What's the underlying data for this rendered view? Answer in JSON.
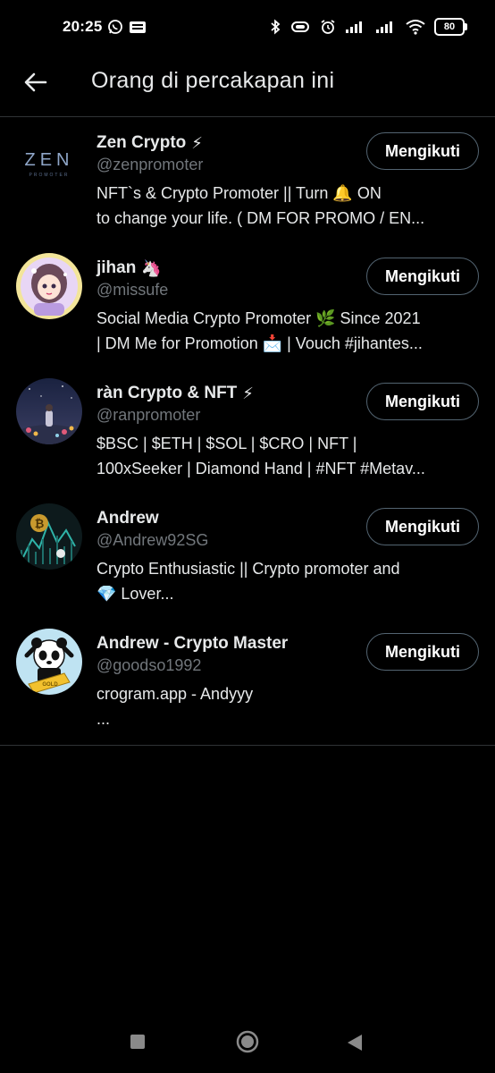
{
  "status_bar": {
    "time": "20:25",
    "battery": "80",
    "icons": [
      "whatsapp-icon",
      "app-notification-icon",
      "bluetooth-icon",
      "vibrate-icon",
      "alarm-icon",
      "signal-icon",
      "signal-icon",
      "wifi-icon",
      "battery-icon"
    ]
  },
  "header": {
    "title": "Orang di percakapan ini",
    "back_icon": "arrow-left-icon"
  },
  "people": [
    {
      "name": "Zen Crypto",
      "name_emoji": "⚡",
      "handle": "@zenpromoter",
      "bio_line1": "NFT`s & Crypto Promoter || Turn 🔔 ON",
      "bio_line2": "to change your life. ( DM FOR PROMO / EN...",
      "follow_label": "Mengikuti",
      "avatar_text": "ZEN",
      "avatar_subtext": "PROMOTER"
    },
    {
      "name": "jihan",
      "name_emoji": "🦄",
      "handle": "@missufe",
      "bio_line1": "Social Media Crypto Promoter 🌿 Since 2021",
      "bio_line2": "| DM Me for Promotion 📩 | Vouch #jihantes...",
      "follow_label": "Mengikuti"
    },
    {
      "name": "ràn Crypto & NFT",
      "name_emoji": "⚡",
      "handle": "@ranpromoter",
      "bio_line1": "$BSC | $ETH | $SOL | $CRO | NFT |",
      "bio_line2": "100xSeeker | Diamond Hand | #NFT #Metav...",
      "follow_label": "Mengikuti"
    },
    {
      "name": "Andrew",
      "name_emoji": "",
      "handle": "@Andrew92SG",
      "bio_line1": "Crypto Enthusiastic || Crypto promoter and",
      "bio_line2": "💎 Lover...",
      "follow_label": "Mengikuti"
    },
    {
      "name": "Andrew - Crypto Master",
      "name_emoji": "",
      "handle": "@goodso1992",
      "bio_line1": "crogram.app - Andyyy",
      "bio_line2": "...",
      "follow_label": "Mengikuti"
    }
  ],
  "nav_bar": {
    "icons": [
      "recents-square-icon",
      "home-circle-icon",
      "back-triangle-icon"
    ]
  },
  "colors": {
    "background": "#000000",
    "text_primary": "#e7e9ea",
    "text_secondary": "#71767b",
    "divider": "#2f3336",
    "button_border": "#536471"
  }
}
